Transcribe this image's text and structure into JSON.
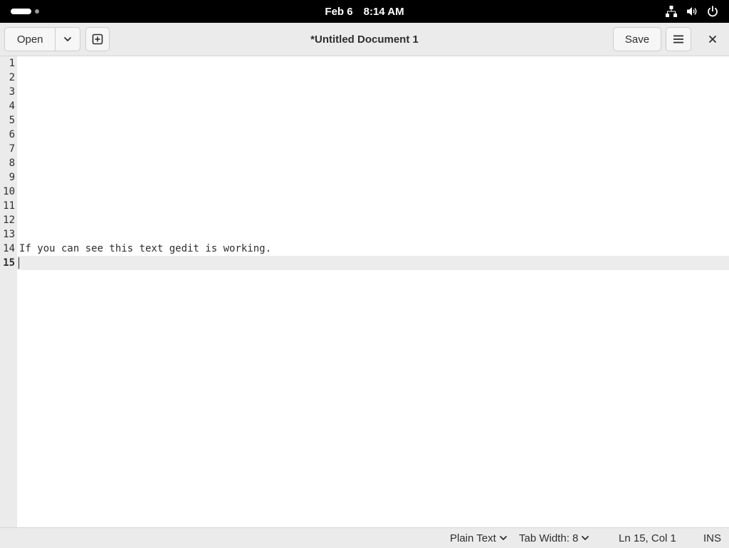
{
  "topbar": {
    "date": "Feb 6",
    "time": "8:14 AM",
    "icons": [
      "network-icon",
      "volume-icon",
      "power-icon"
    ]
  },
  "headerbar": {
    "open_label": "Open",
    "save_label": "Save",
    "title": "*Untitled Document 1",
    "icons": [
      "chevron-down-icon",
      "new-tab-icon",
      "hamburger-menu-icon",
      "close-icon"
    ]
  },
  "editor": {
    "lines": [
      {
        "num": "1",
        "text": ""
      },
      {
        "num": "2",
        "text": ""
      },
      {
        "num": "3",
        "text": ""
      },
      {
        "num": "4",
        "text": ""
      },
      {
        "num": "5",
        "text": ""
      },
      {
        "num": "6",
        "text": ""
      },
      {
        "num": "7",
        "text": ""
      },
      {
        "num": "8",
        "text": ""
      },
      {
        "num": "9",
        "text": ""
      },
      {
        "num": "10",
        "text": ""
      },
      {
        "num": "11",
        "text": ""
      },
      {
        "num": "12",
        "text": ""
      },
      {
        "num": "13",
        "text": ""
      },
      {
        "num": "14",
        "text": "If you can see this text gedit is working."
      },
      {
        "num": "15",
        "text": ""
      }
    ],
    "current_line": 15
  },
  "statusbar": {
    "language": "Plain Text",
    "tab_width": "Tab Width: 8",
    "position": "Ln 15, Col 1",
    "mode": "INS"
  },
  "colors": {
    "topbar_bg": "#000000",
    "headerbar_bg": "#ebebeb",
    "gutter_bg": "#ebebeb",
    "current_line_bg": "#ececec",
    "text": "#2e2e2e"
  }
}
